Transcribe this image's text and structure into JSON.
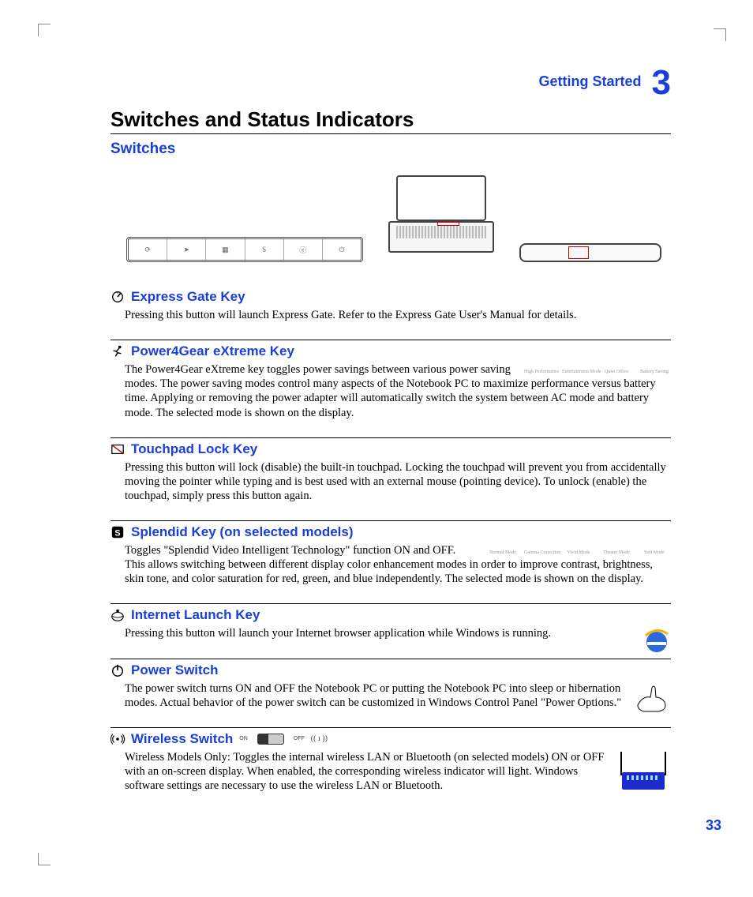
{
  "header": {
    "breadcrumb": "Getting Started",
    "chapter_num": "3"
  },
  "title": "Switches and Status Indicators",
  "subtitle": "Switches",
  "modes_power4gear": [
    "High Performance",
    "Entertainment Mode",
    "Quiet Office",
    "Battery Saving"
  ],
  "modes_splendid": [
    "Normal Mode",
    "Gamma Correction",
    "Vivid Mode",
    "Theater Mode",
    "Soft Mode"
  ],
  "wireless_labels": {
    "on": "ON",
    "off": "OFF"
  },
  "sections": {
    "express": {
      "title": "Express Gate Key",
      "body": "Pressing this button will launch Express Gate. Refer to the Express Gate User's Manual for details."
    },
    "power4gear": {
      "title": "Power4Gear eXtreme Key",
      "body": "The Power4Gear eXtreme key toggles power savings between various power saving modes. The power saving modes control many aspects of the Notebook PC to maximize performance versus battery time. Applying or removing the power adapter will automatically switch the system between AC mode and battery mode. The selected mode is shown on the display."
    },
    "touchpad": {
      "title": "Touchpad Lock Key",
      "body": "Pressing this button will lock (disable) the built-in touchpad. Locking the touchpad will prevent you from accidentally moving the pointer while typing and is best used with an external mouse (pointing device). To unlock (enable) the touchpad, simply press this button again."
    },
    "splendid": {
      "title": "Splendid Key (on selected models)",
      "body": "Toggles \"Splendid Video Intelligent Technology\" function ON and OFF. This allows switching between different display color enhancement modes in order to improve contrast, brightness, skin tone, and color saturation for red, green, and blue independently. The selected mode is shown on the display."
    },
    "internet": {
      "title": "Internet Launch Key",
      "body": "Pressing this button will launch your Internet browser application while Windows is running."
    },
    "power": {
      "title": "Power Switch",
      "body": "The power switch turns ON and OFF the Notebook PC or putting the Notebook PC into sleep or hibernation modes. Actual behavior of the power switch can be customized in Windows Control Panel \"Power Options.\""
    },
    "wireless": {
      "title": "Wireless Switch",
      "body": "Wireless Models Only: Toggles the internal wireless LAN or Bluetooth (on selected models) ON or OFF with an on-screen display. When enabled, the corresponding wireless indicator will light. Windows software settings are necessary to use the wireless LAN or Bluetooth."
    }
  },
  "page_number": "33"
}
